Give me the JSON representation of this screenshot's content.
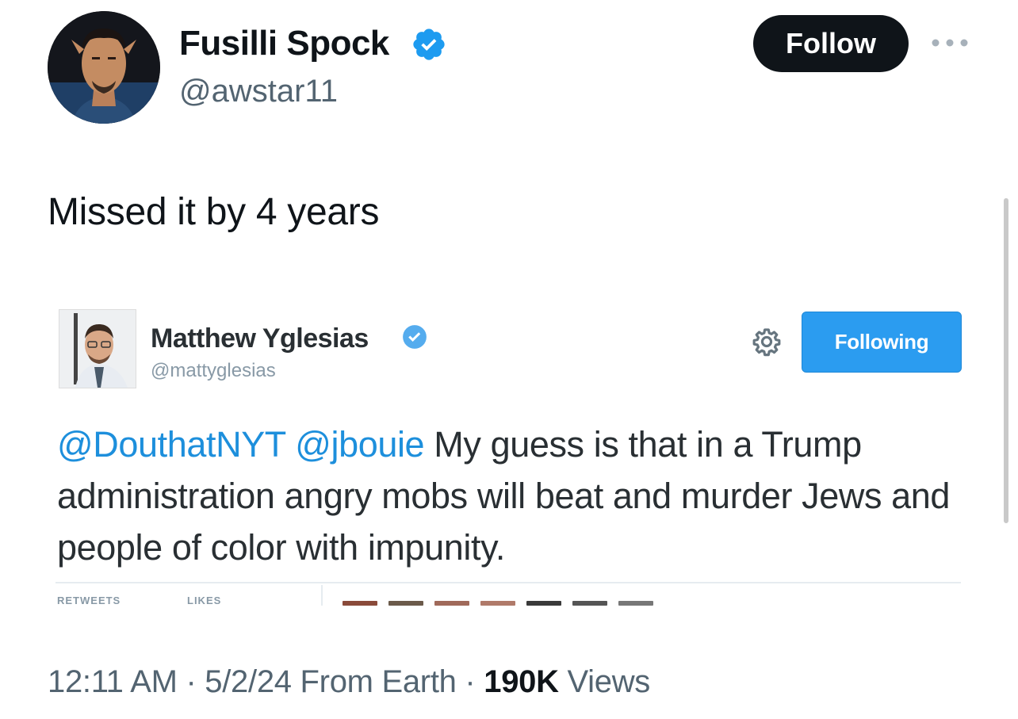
{
  "author": {
    "display_name": "Fusilli Spock",
    "handle": "@awstar11",
    "verified": true
  },
  "actions": {
    "follow_label": "Follow"
  },
  "tweet": {
    "text": "Missed it by 4 years"
  },
  "embedded_tweet": {
    "author_name": "Matthew Yglesias",
    "author_handle": "@mattyglesias",
    "verified": true,
    "button_label": "Following",
    "mentions": [
      "@DouthatNYT",
      "@jbouie"
    ],
    "body": "My guess is that in a Trump administration angry mobs will beat and murder Jews and people of color with impunity.",
    "stats_labels": [
      "RETWEETS",
      "LIKES"
    ]
  },
  "meta": {
    "time": "12:11 AM",
    "date": "5/2/24",
    "source": "From Earth",
    "views_count": "190K",
    "views_label": "Views"
  },
  "colors": {
    "follow_bg": "#0f1419",
    "verified": "#1d9bf0",
    "mention": "#1d8fdc",
    "following_bg": "#2b9cf0",
    "secondary_text": "#536471"
  },
  "icons": {
    "verified": "verified-badge-icon",
    "more": "more-horizontal-icon",
    "settings": "gear-icon"
  }
}
